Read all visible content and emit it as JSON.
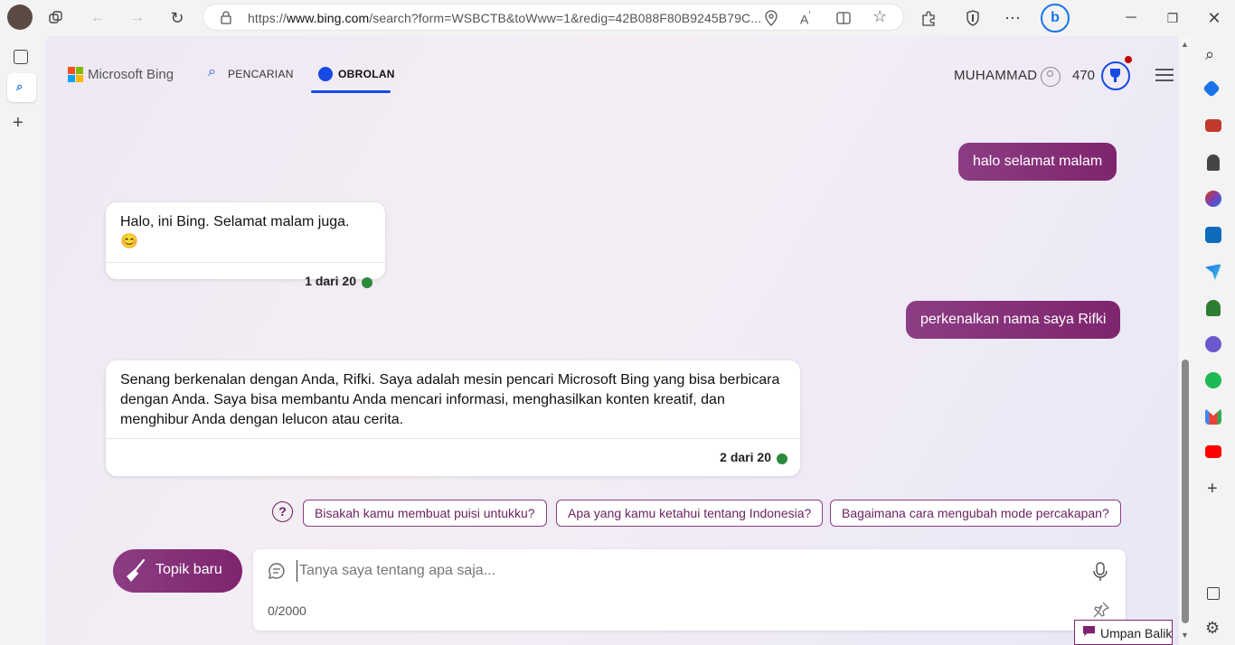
{
  "browser": {
    "url_prefix": "https://",
    "url_domain": "www.bing.com",
    "url_rest": "/search?form=WSBCTB&toWww=1&redig=42B088F80B9245B79C..."
  },
  "header": {
    "brand": "Microsoft Bing",
    "nav_search": "PENCARIAN",
    "nav_chat": "OBROLAN",
    "user_name": "MUHAMMAD",
    "points": "470"
  },
  "chat": {
    "user_msg_1": "halo selamat malam",
    "bot_msg_1": "Halo, ini Bing. Selamat malam juga. 😊",
    "bot_count_1": "1 dari 20",
    "user_msg_2": "perkenalkan nama saya Rifki",
    "bot_msg_2": "Senang berkenalan dengan Anda, Rifki. Saya adalah mesin pencari Microsoft Bing yang bisa berbicara dengan Anda. Saya bisa membantu Anda mencari informasi, menghasilkan konten kreatif, dan menghibur Anda dengan lelucon atau cerita.",
    "bot_count_2": "2 dari 20"
  },
  "suggestions": [
    "Bisakah kamu membuat puisi untukku?",
    "Apa yang kamu ketahui tentang Indonesia?",
    "Bagaimana cara mengubah mode percakapan?"
  ],
  "composer": {
    "new_topic_label": "Topik baru",
    "placeholder": "Tanya saya tentang apa saja...",
    "char_count": "0/2000"
  },
  "feedback_label": "Umpan Balik",
  "colors": {
    "accent": "#7f246e",
    "nav_underline": "#174ae4",
    "status_dot": "#2b8a3e"
  }
}
